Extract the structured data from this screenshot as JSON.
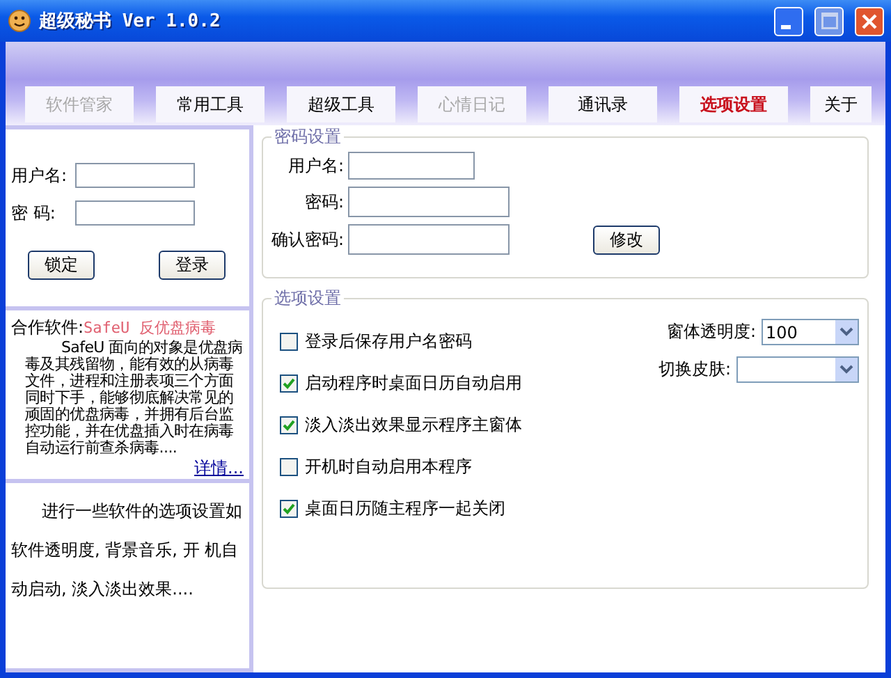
{
  "window": {
    "title": "超级秘书 Ver 1.0.2"
  },
  "tabs": [
    {
      "label": "软件管家",
      "selected": false,
      "disabled": true
    },
    {
      "label": "常用工具",
      "selected": false,
      "disabled": false
    },
    {
      "label": "超级工具",
      "selected": false,
      "disabled": false
    },
    {
      "label": "心情日记",
      "selected": false,
      "disabled": true
    },
    {
      "label": "通讯录",
      "selected": false,
      "disabled": false
    },
    {
      "label": "选项设置",
      "selected": true,
      "disabled": false
    },
    {
      "label": "关于",
      "selected": false,
      "disabled": false
    }
  ],
  "login": {
    "fields": [
      {
        "label": "用户名:"
      },
      {
        "label": "密 码:"
      }
    ],
    "buttons": [
      "锁定",
      "登录"
    ]
  },
  "partner": {
    "label": "合作软件:",
    "product": "SafeU 反优盘病毒",
    "description": "SafeU 面向的对象是优盘病毒及其残留物，能有效的从病毒文件，进程和注册表项三个方面同时下手，能够彻底解决常见的顽固的优盘病毒，并拥有后台监控功能，并在优盘插入时在病毒自动运行前查杀病毒....",
    "link": "详情..."
  },
  "help": {
    "text": "进行一些软件的选项设置如软件透明度, 背景音乐, 开 机自动启动, 淡入淡出效果...."
  },
  "password_group": {
    "title": "密码设置",
    "fields": [
      {
        "label": "用户名:"
      },
      {
        "label": "密码:"
      },
      {
        "label": "确认密码:"
      }
    ],
    "button": "修改"
  },
  "options_group": {
    "title": "选项设置",
    "checkboxes": [
      {
        "label": "登录后保存用户名密码",
        "checked": false
      },
      {
        "label": "启动程序时桌面日历自动启用",
        "checked": true
      },
      {
        "label": "淡入淡出效果显示程序主窗体",
        "checked": true
      },
      {
        "label": "开机时自动启用本程序",
        "checked": false
      },
      {
        "label": "桌面日历随主程序一起关闭",
        "checked": true
      }
    ],
    "dropdowns": [
      {
        "label": "窗体透明度:",
        "value": "100"
      },
      {
        "label": "切换皮肤:"
      }
    ]
  }
}
